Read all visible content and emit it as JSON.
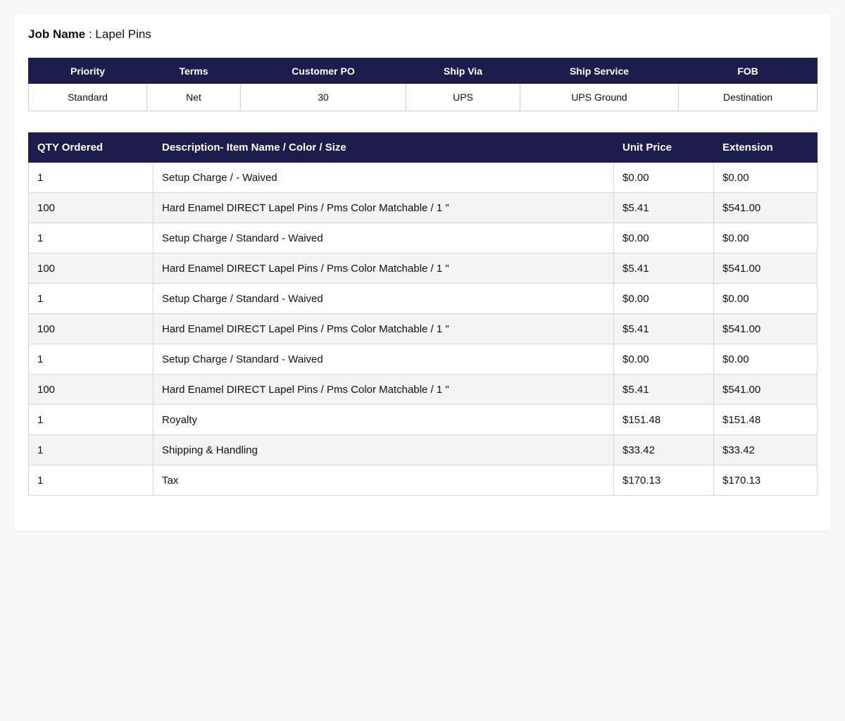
{
  "job": {
    "label": "Job Name",
    "separator": " : ",
    "value": "Lapel Pins"
  },
  "info": {
    "headers": [
      "Priority",
      "Terms",
      "Customer PO",
      "Ship Via",
      "Ship Service",
      "FOB"
    ],
    "values": [
      "Standard",
      "Net",
      "30",
      "UPS",
      "UPS Ground",
      "Destination"
    ]
  },
  "items": {
    "headers": [
      "QTY Ordered",
      "Description- Item Name / Color / Size",
      "Unit Price",
      "Extension"
    ],
    "rows": [
      [
        "1",
        "Setup Charge / - Waived",
        "$0.00",
        "$0.00"
      ],
      [
        "100",
        "Hard Enamel DIRECT Lapel Pins / Pms Color Matchable / 1 \"",
        "$5.41",
        "$541.00"
      ],
      [
        "1",
        "Setup Charge / Standard - Waived",
        "$0.00",
        "$0.00"
      ],
      [
        "100",
        "Hard Enamel DIRECT Lapel Pins / Pms Color Matchable / 1 \"",
        "$5.41",
        "$541.00"
      ],
      [
        "1",
        "Setup Charge / Standard - Waived",
        "$0.00",
        "$0.00"
      ],
      [
        "100",
        "Hard Enamel DIRECT Lapel Pins / Pms Color Matchable / 1 \"",
        "$5.41",
        "$541.00"
      ],
      [
        "1",
        "Setup Charge / Standard - Waived",
        "$0.00",
        "$0.00"
      ],
      [
        "100",
        "Hard Enamel DIRECT Lapel Pins / Pms Color Matchable / 1 \"",
        "$5.41",
        "$541.00"
      ],
      [
        "1",
        "Royalty",
        "$151.48",
        "$151.48"
      ],
      [
        "1",
        "Shipping & Handling",
        "$33.42",
        "$33.42"
      ],
      [
        "1",
        "Tax",
        "$170.13",
        "$170.13"
      ]
    ]
  },
  "colors": {
    "header_bg": "#1c1c4d",
    "header_text": "#ffffff",
    "row_alt_bg": "#f4f4f4"
  }
}
